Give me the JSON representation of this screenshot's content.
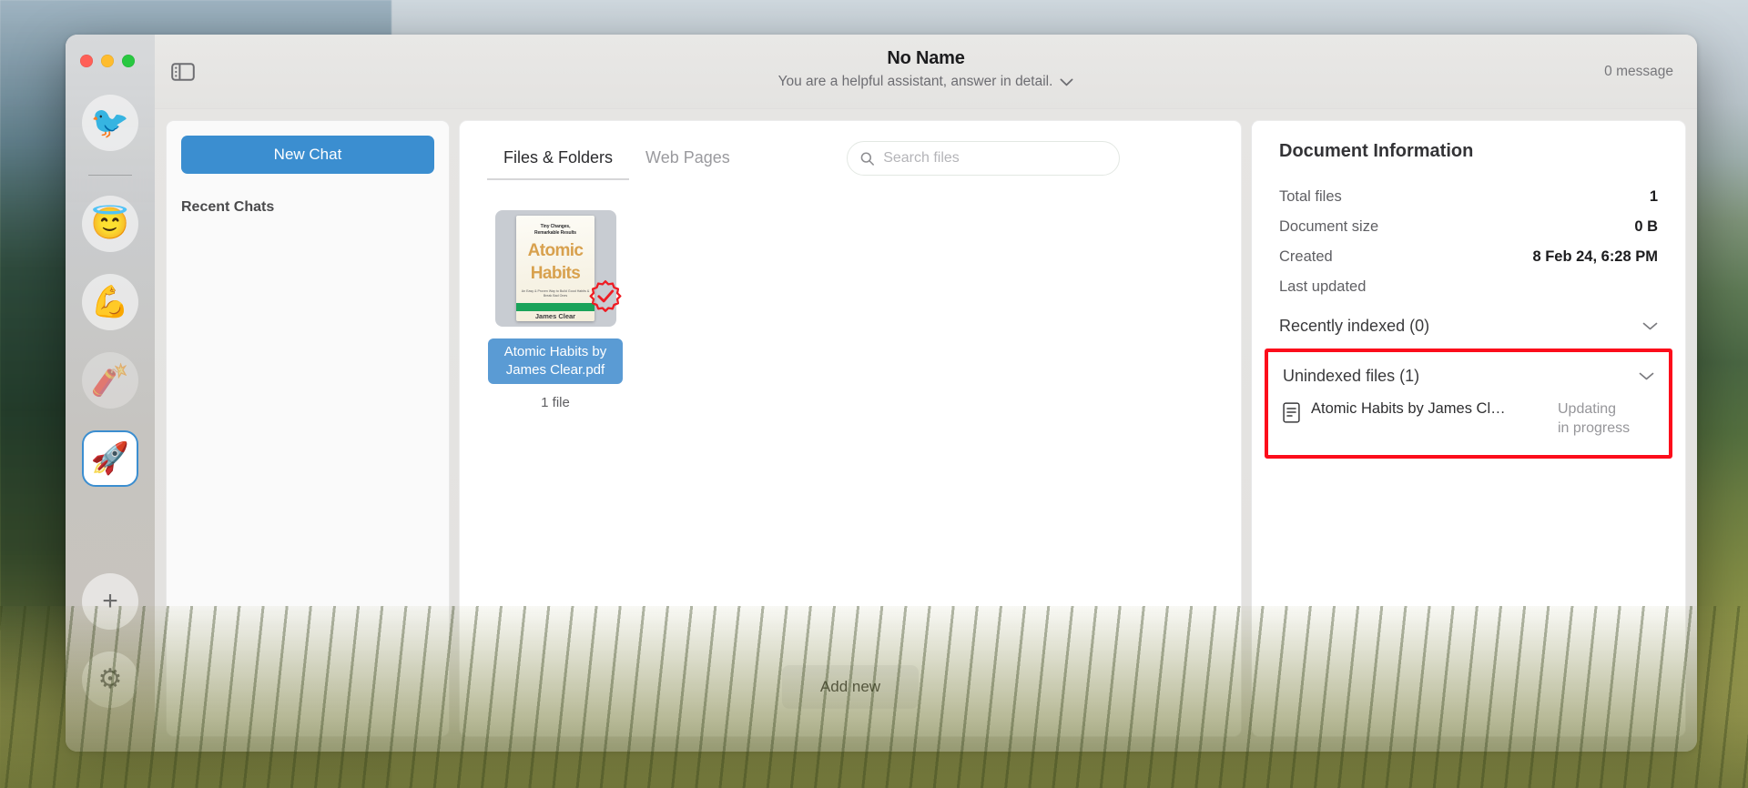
{
  "window": {
    "traffic_lights": [
      "close",
      "minimize",
      "maximize"
    ]
  },
  "rail": {
    "items": [
      {
        "name": "bird",
        "glyph": "🐦",
        "selected": false,
        "dim": false
      },
      {
        "name": "angel",
        "glyph": "😇",
        "selected": false,
        "dim": false
      },
      {
        "name": "muscle",
        "glyph": "💪",
        "selected": false,
        "dim": false
      },
      {
        "name": "firecracker",
        "glyph": "🧨",
        "selected": false,
        "dim": true
      },
      {
        "name": "rocket",
        "glyph": "🚀",
        "selected": true,
        "dim": false
      }
    ],
    "add_label": "+",
    "settings_label": "⚙"
  },
  "header": {
    "sidebar_toggle_icon": "sidebar-toggle-icon",
    "title": "No Name",
    "subtitle": "You are a helpful assistant, answer in detail.",
    "subtitle_chevron": "chevron-down-icon",
    "message_count": "0 message"
  },
  "sidebar": {
    "new_chat_label": "New Chat",
    "recent_chats_label": "Recent Chats",
    "recent_chats": []
  },
  "main": {
    "tabs": [
      {
        "label": "Files & Folders",
        "active": true
      },
      {
        "label": "Web Pages",
        "active": false
      }
    ],
    "search": {
      "placeholder": "Search files",
      "value": "",
      "icon": "search-icon"
    },
    "files": [
      {
        "name": "Atomic Habits by James Clear.pdf",
        "selected": true,
        "cover": {
          "tagline": "Tiny Changes,\nRemarkable Results",
          "title_line1": "Atomic",
          "title_line2": "Habits",
          "subtitle": "An Easy & Proven Way to Build Good Habits & Break Bad Ones",
          "author": "James Clear"
        },
        "badge": "check-badge-icon"
      }
    ],
    "file_count_label": "1 file",
    "add_new_label": "Add new"
  },
  "doc_panel": {
    "title": "Document Information",
    "rows": [
      {
        "label": "Total files",
        "value": "1"
      },
      {
        "label": "Document size",
        "value": "0 B"
      },
      {
        "label": "Created",
        "value": "8 Feb 24, 6:28 PM"
      },
      {
        "label": "Last updated",
        "value": ""
      }
    ],
    "recently_indexed": {
      "label": "Recently indexed (0)",
      "chevron": "⌄",
      "items": []
    },
    "unindexed": {
      "label": "Unindexed files (1)",
      "chevron": "⌄",
      "highlight_color": "#fc0d1b",
      "items": [
        {
          "icon": "document-icon",
          "name": "Atomic Habits by James Cl…",
          "status": "Updating\nin progress"
        }
      ]
    }
  }
}
